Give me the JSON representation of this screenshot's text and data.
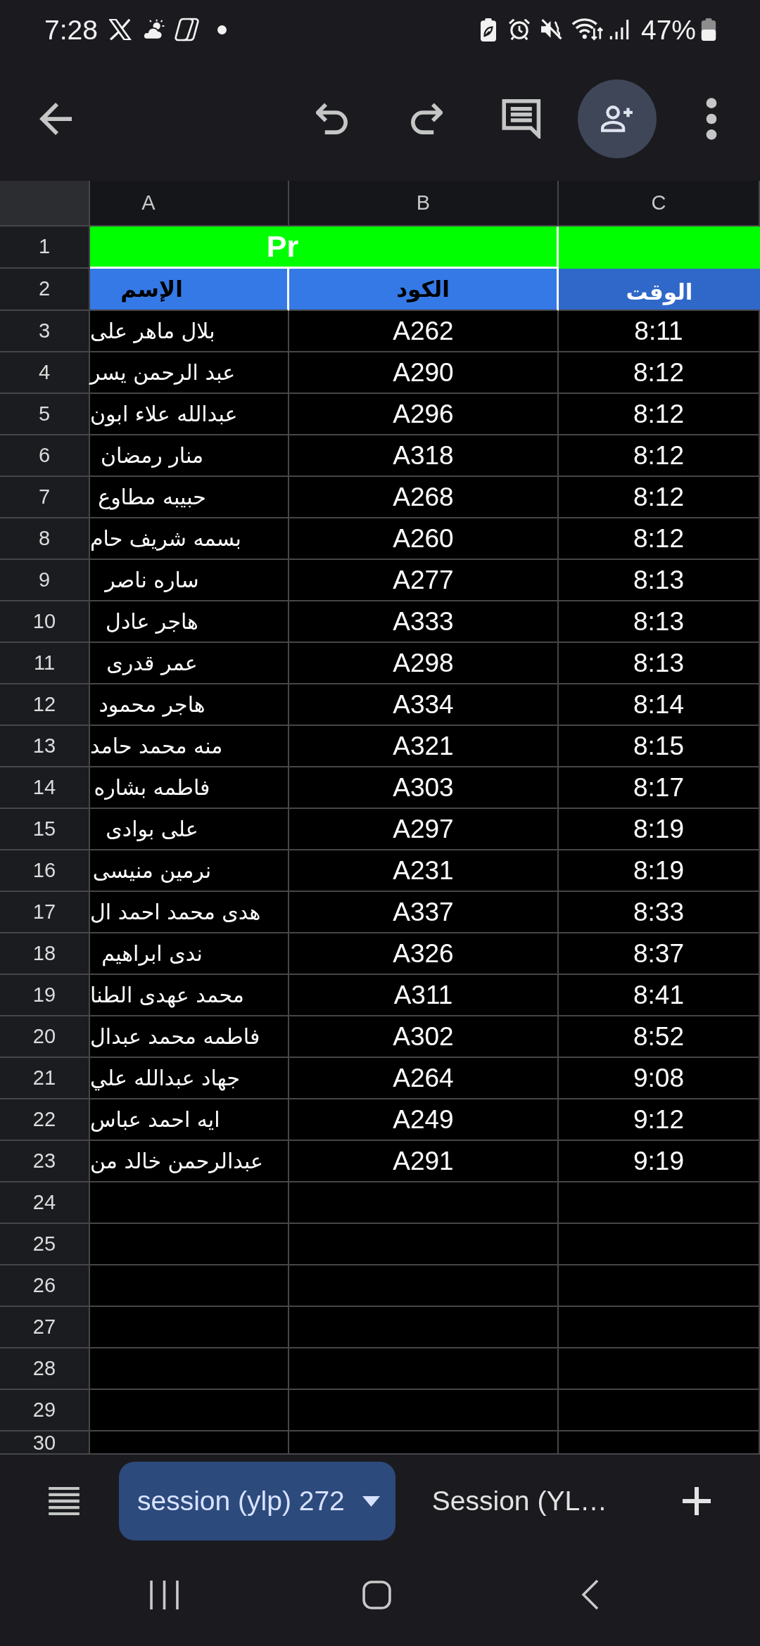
{
  "status_bar": {
    "time": "7:28",
    "battery": "47%"
  },
  "sheet": {
    "column_headers": {
      "a": "A",
      "b": "B",
      "c": "C"
    },
    "rows": [
      {
        "number": "1",
        "kind": "title",
        "title": "Pr"
      },
      {
        "number": "2",
        "kind": "header",
        "name": "الإسم",
        "code": "الكود",
        "time": "الوقت"
      },
      {
        "number": "3",
        "kind": "data",
        "name": "بلال ماهر على",
        "code": "A262",
        "time": "8:11"
      },
      {
        "number": "4",
        "kind": "data",
        "name": "عبد الرحمن يسر",
        "code": "A290",
        "time": "8:12"
      },
      {
        "number": "5",
        "kind": "data",
        "name": "عبدالله علاء ابون",
        "code": "A296",
        "time": "8:12"
      },
      {
        "number": "6",
        "kind": "data",
        "name": "منار رمضان",
        "code": "A318",
        "time": "8:12"
      },
      {
        "number": "7",
        "kind": "data",
        "name": "حبيبه مطاوع",
        "code": "A268",
        "time": "8:12"
      },
      {
        "number": "8",
        "kind": "data",
        "name": "بسمه شريف حام",
        "code": "A260",
        "time": "8:12"
      },
      {
        "number": "9",
        "kind": "data",
        "name": "ساره ناصر",
        "code": "A277",
        "time": "8:13"
      },
      {
        "number": "10",
        "kind": "data",
        "name": "هاجر عادل",
        "code": "A333",
        "time": "8:13"
      },
      {
        "number": "11",
        "kind": "data",
        "name": "عمر قدرى",
        "code": "A298",
        "time": "8:13"
      },
      {
        "number": "12",
        "kind": "data",
        "name": "هاجر محمود",
        "code": "A334",
        "time": "8:14"
      },
      {
        "number": "13",
        "kind": "data",
        "name": "منه محمد حامد",
        "code": "A321",
        "time": "8:15"
      },
      {
        "number": "14",
        "kind": "data",
        "name": "فاطمه بشاره",
        "code": "A303",
        "time": "8:17"
      },
      {
        "number": "15",
        "kind": "data",
        "name": "على بوادى",
        "code": "A297",
        "time": "8:19"
      },
      {
        "number": "16",
        "kind": "data",
        "name": "نرمين منيسى",
        "code": "A231",
        "time": "8:19"
      },
      {
        "number": "17",
        "kind": "data",
        "name": "هدى محمد احمد ال",
        "code": "A337",
        "time": "8:33"
      },
      {
        "number": "18",
        "kind": "data",
        "name": "ندى ابراهيم",
        "code": "A326",
        "time": "8:37"
      },
      {
        "number": "19",
        "kind": "data",
        "name": "محمد عهدى الطنا",
        "code": "A311",
        "time": "8:41"
      },
      {
        "number": "20",
        "kind": "data",
        "name": "فاطمه محمد عبدال",
        "code": "A302",
        "time": "8:52"
      },
      {
        "number": "21",
        "kind": "data",
        "name": "جهاد عبدالله علي",
        "code": "A264",
        "time": "9:08"
      },
      {
        "number": "22",
        "kind": "data",
        "name": "ايه احمد عباس",
        "code": "A249",
        "time": "9:12"
      },
      {
        "number": "23",
        "kind": "data",
        "name": "عبدالرحمن خالد من",
        "code": "A291",
        "time": "9:19"
      },
      {
        "number": "24",
        "kind": "empty"
      },
      {
        "number": "25",
        "kind": "empty"
      },
      {
        "number": "26",
        "kind": "empty"
      },
      {
        "number": "27",
        "kind": "empty"
      },
      {
        "number": "28",
        "kind": "empty"
      },
      {
        "number": "29",
        "kind": "empty"
      },
      {
        "number": "30",
        "kind": "empty"
      }
    ]
  },
  "sheet_tabs": {
    "first": {
      "label": "session (ylp) 272",
      "selected": true
    },
    "second": {
      "label": "Session (YL…",
      "selected": false
    }
  }
}
